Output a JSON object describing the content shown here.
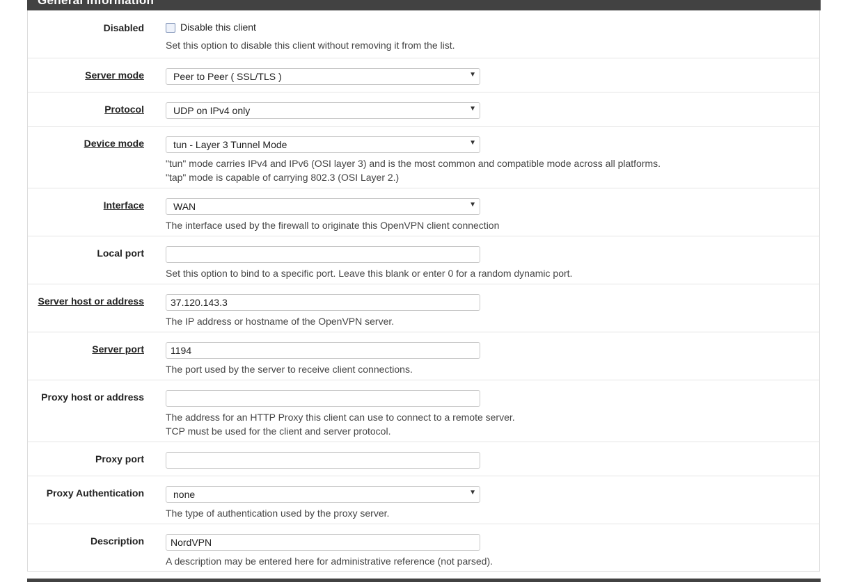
{
  "section_title": "General Information",
  "rows": {
    "disabled": {
      "label": "Disabled",
      "checkbox_label": "Disable this client",
      "help": "Set this option to disable this client without removing it from the list."
    },
    "server_mode": {
      "label": "Server mode",
      "value": "Peer to Peer ( SSL/TLS )"
    },
    "protocol": {
      "label": "Protocol",
      "value": "UDP on IPv4 only"
    },
    "device_mode": {
      "label": "Device mode",
      "value": "tun - Layer 3 Tunnel Mode",
      "help1": "\"tun\" mode carries IPv4 and IPv6 (OSI layer 3) and is the most common and compatible mode across all platforms.",
      "help2": "\"tap\" mode is capable of carrying 802.3 (OSI Layer 2.)"
    },
    "interface": {
      "label": "Interface",
      "value": "WAN",
      "help": "The interface used by the firewall to originate this OpenVPN client connection"
    },
    "local_port": {
      "label": "Local port",
      "value": "",
      "help": "Set this option to bind to a specific port. Leave this blank or enter 0 for a random dynamic port."
    },
    "server_host": {
      "label": "Server host or address",
      "value": "37.120.143.3",
      "help": "The IP address or hostname of the OpenVPN server."
    },
    "server_port": {
      "label": "Server port",
      "value": "1194",
      "help": "The port used by the server to receive client connections."
    },
    "proxy_host": {
      "label": "Proxy host or address",
      "value": "",
      "help1": "The address for an HTTP Proxy this client can use to connect to a remote server.",
      "help2": "TCP must be used for the client and server protocol."
    },
    "proxy_port": {
      "label": "Proxy port",
      "value": ""
    },
    "proxy_auth": {
      "label": "Proxy Authentication",
      "value": "none",
      "help": "The type of authentication used by the proxy server."
    },
    "description": {
      "label": "Description",
      "value": "NordVPN",
      "help": "A description may be entered here for administrative reference (not parsed)."
    }
  },
  "icons": {
    "caret": "caret-down-icon"
  },
  "colors": {
    "heading_bg": "#424242",
    "checkbox_border": "#7b8fb5"
  }
}
